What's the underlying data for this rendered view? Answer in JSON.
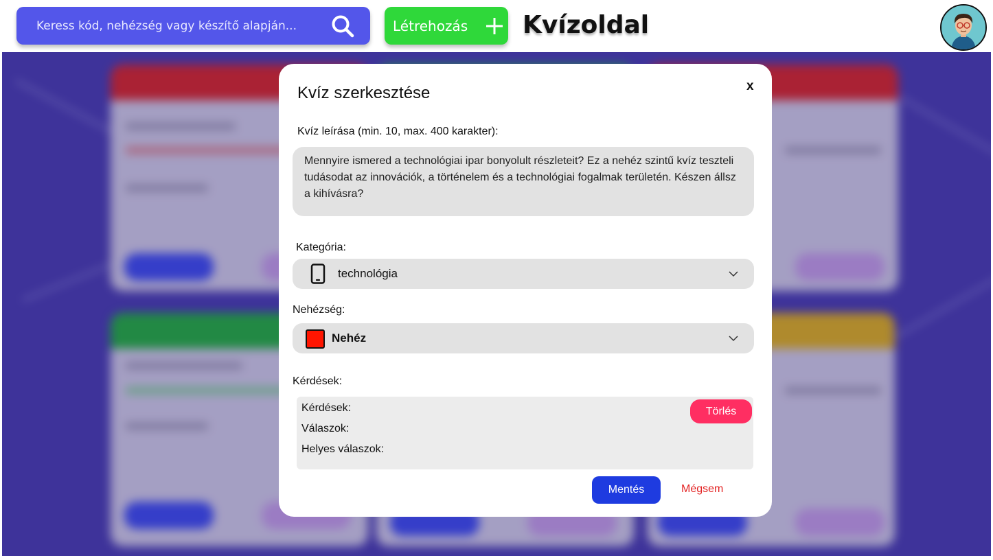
{
  "header": {
    "search_placeholder": "Keress kód, nehézség vagy készítő alapján...",
    "create_label": "Létrehozás",
    "site_title": "Kvízoldal"
  },
  "modal": {
    "title": "Kvíz szerkesztése",
    "close_label": "x",
    "description_label": "Kvíz leírása (min. 10, max. 400 karakter):",
    "description_value": "Mennyire ismered a technológiai ipar bonyolult részleteit? Ez a nehéz szintű kvíz teszteli tudásodat az innovációk, a történelem és a technológiai fogalmak területén. Készen állsz a kihívásra?",
    "category_label": "Kategória:",
    "category_value": "technológia",
    "category_icon": "phone-icon",
    "difficulty_label": "Nehézség:",
    "difficulty_value": "Nehéz",
    "difficulty_color": "#ff1500",
    "questions_label": "Kérdések:",
    "question_item": {
      "questions": "Kérdések:",
      "answers": "Válaszok:",
      "correct_answers": "Helyes válaszok:",
      "delete_label": "Törlés"
    },
    "save_label": "Mentés",
    "cancel_label": "Mégsem"
  },
  "colors": {
    "search_bg": "#5356ea",
    "create_bg": "#2fd83a",
    "background": "#3b2fa8",
    "delete_bg": "#ff2e62",
    "save_bg": "#1e3be0",
    "cancel_text": "#e32222"
  }
}
